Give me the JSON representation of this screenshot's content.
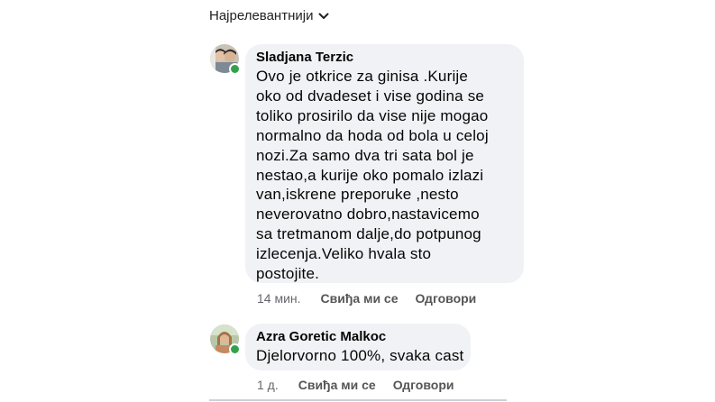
{
  "sort": {
    "label": "Најрелевантнији"
  },
  "comments": [
    {
      "author": "Sladjana Terzic",
      "lines": [
        "Ovo je otkrice za ginisa .Kurije",
        "oko od dvadeset i vise godina se",
        "toliko prosirilo da vise nije mogao",
        "normalno da hoda od bola u celoj",
        "nozi.Za samo dva tri sata bol je",
        "nestao,a kurije oko pomalo izlazi",
        "van,iskrene preporuke ,nesto",
        "neverovatno dobro,nastavicemo",
        "sa tretmanom dalje,do potpunog",
        "izlecenja.Veliko hvala sto",
        "postojite."
      ],
      "time": "14 мин.",
      "like_label": "Свиђа ми се",
      "reply_label": "Одговори"
    },
    {
      "author": "Azra Goretic Malkoc",
      "lines": [
        "Djelorvorno 100%, svaka cast"
      ],
      "time": "1 д.",
      "like_label": "Свиђа ми се",
      "reply_label": "Одговори"
    }
  ],
  "colors": {
    "bubble": "#f0f2f5",
    "online": "#31a24c",
    "meta": "#65676b"
  }
}
